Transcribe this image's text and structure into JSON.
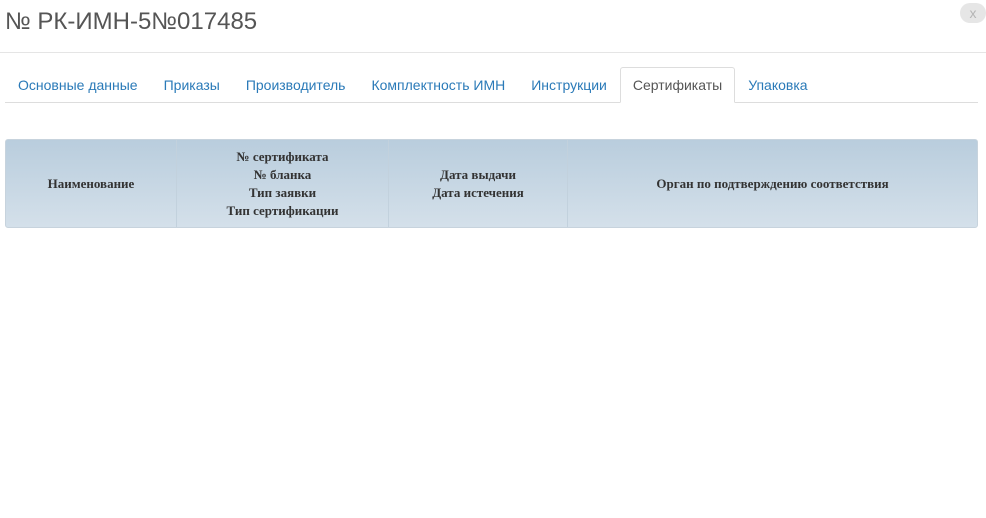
{
  "modal": {
    "title": "№ РК-ИМН-5№017485",
    "close_label": "x"
  },
  "tabs": [
    {
      "label": "Основные данные",
      "active": false
    },
    {
      "label": "Приказы",
      "active": false
    },
    {
      "label": "Производитель",
      "active": false
    },
    {
      "label": "Комплектность ИМН",
      "active": false
    },
    {
      "label": "Инструкции",
      "active": false
    },
    {
      "label": "Сертификаты",
      "active": true
    },
    {
      "label": "Упаковка",
      "active": false
    }
  ],
  "table": {
    "columns": {
      "name": "Наименование",
      "cert": [
        "№ сертификата",
        "№ бланка",
        "Тип заявки",
        "Тип сертификации"
      ],
      "dates": [
        "Дата выдачи",
        "Дата истечения"
      ],
      "organ": "Орган по подтверждению соответствия"
    },
    "rows": []
  },
  "colors": {
    "tab_link": "#2a7ab8",
    "header_gradient_top": "#b9cddd",
    "header_gradient_bottom": "#d4e0ea"
  }
}
